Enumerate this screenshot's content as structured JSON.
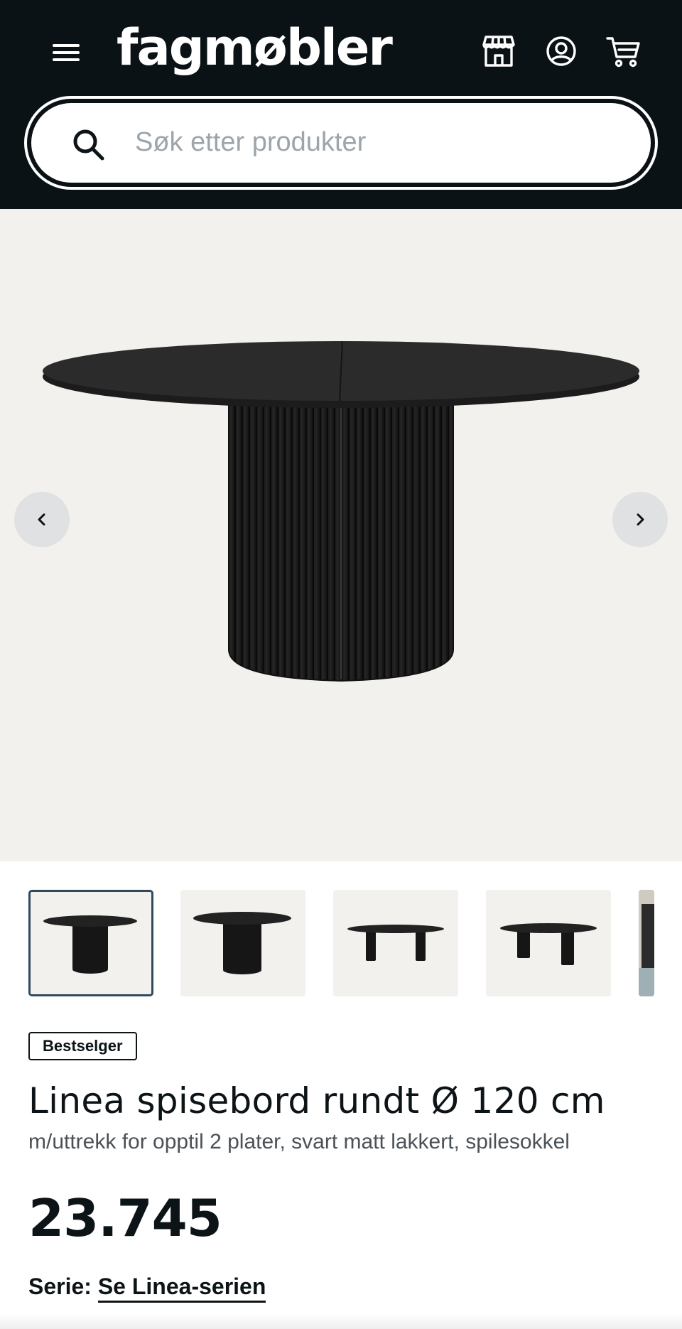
{
  "header": {
    "logo": "fagmøbler",
    "icons": [
      "menu-icon",
      "store-icon",
      "account-icon",
      "cart-icon"
    ],
    "background": "#0b1216"
  },
  "search": {
    "placeholder": "Søk etter produkter",
    "value": ""
  },
  "gallery": {
    "background": "#f2f1ee",
    "thumbnail_count": 5,
    "active_thumbnail": 1
  },
  "product": {
    "badge": "Bestselger",
    "title": "Linea spisebord rundt Ø 120 cm",
    "subtitle": "m/uttrekk for opptil 2 plater, svart matt lakkert, spilesokkel",
    "price": "23.745",
    "series_label": "Serie:",
    "series_link": "Se Linea-serien"
  },
  "colors": {
    "accent": "#2f4a5e",
    "text": "#0d1417",
    "muted": "#4a5258"
  }
}
